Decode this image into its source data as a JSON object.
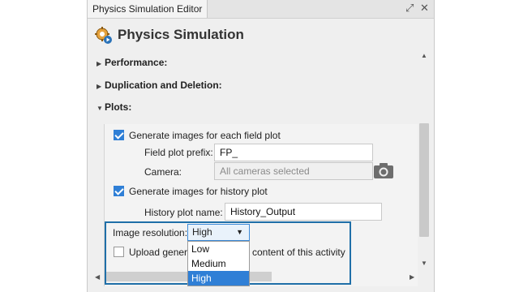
{
  "window": {
    "tab_title": "Physics Simulation Editor",
    "expand_icon": "expand-icon",
    "close_icon": "close-icon"
  },
  "header": {
    "title": "Physics Simulation",
    "icon": "gear-icon"
  },
  "sections": {
    "performance": "Performance:",
    "duplication": "Duplication and Deletion:",
    "plots": "Plots:"
  },
  "plots": {
    "gen_field_label": "Generate images for each field plot",
    "field_prefix_label": "Field plot prefix:",
    "field_prefix_value": "FP_",
    "camera_label": "Camera:",
    "camera_value": "All cameras selected",
    "gen_history_label": "Generate images for history plot",
    "history_name_label": "History plot name:",
    "history_name_value": "History_Output",
    "image_resolution_label": "Image resolution:",
    "image_resolution_value": "High",
    "resolution_options": [
      "Low",
      "Medium",
      "High"
    ],
    "upload_label_left": "Upload genera",
    "upload_label_right": "content of this activity"
  },
  "colors": {
    "accent": "#2f7fd6",
    "highlight_border": "#1f6fa8"
  }
}
